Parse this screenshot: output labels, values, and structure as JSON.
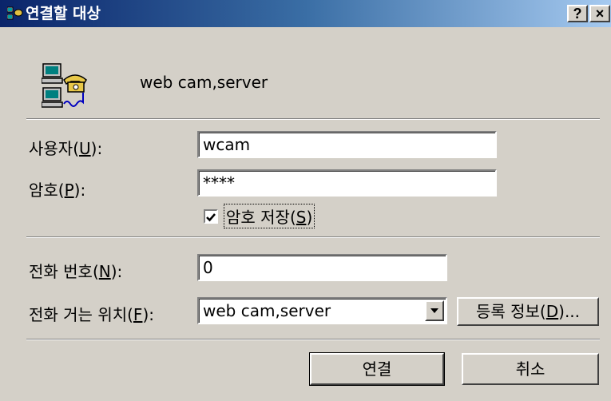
{
  "window": {
    "title": "연결할 대상",
    "help_label": "?",
    "close_label": "×"
  },
  "connection": {
    "name": "web cam,server"
  },
  "user": {
    "label_prefix": "사용자(",
    "label_key": "U",
    "label_suffix": "):",
    "value": "wcam"
  },
  "password": {
    "label_prefix": "암호(",
    "label_key": "P",
    "label_suffix": "):",
    "value": "****"
  },
  "save_password": {
    "label_prefix": "암호 저장(",
    "label_key": "S",
    "label_suffix": ")",
    "checked": true
  },
  "phone": {
    "label_prefix": "전화 번호(",
    "label_key": "N",
    "label_suffix": "):",
    "value": "0"
  },
  "dialing_from": {
    "label_prefix": "전화 거는 위치(",
    "label_key": "F",
    "label_suffix": "):",
    "selected": "web cam,server"
  },
  "dialing_properties": {
    "label_prefix": "등록 정보(",
    "label_key": "D",
    "label_suffix": ")..."
  },
  "buttons": {
    "connect_label": "연결",
    "cancel_label": "취소"
  }
}
